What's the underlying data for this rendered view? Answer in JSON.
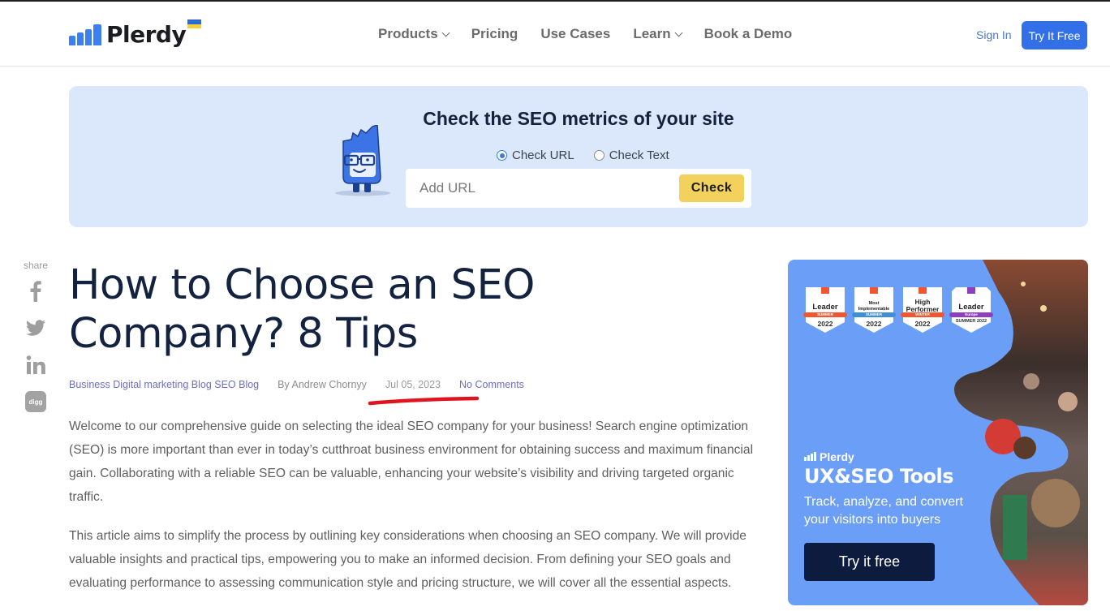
{
  "header": {
    "logo_text": "Plerdy",
    "nav": [
      {
        "label": "Products",
        "has_dropdown": true
      },
      {
        "label": "Pricing",
        "has_dropdown": false
      },
      {
        "label": "Use Cases",
        "has_dropdown": false
      },
      {
        "label": "Learn",
        "has_dropdown": true
      },
      {
        "label": "Book a Demo",
        "has_dropdown": false
      }
    ],
    "sign_in": "Sign In",
    "try_free": "Try It Free",
    "accent_color": "#3370e8"
  },
  "seo_checker": {
    "title": "Check the SEO metrics of your site",
    "radio_options": [
      {
        "label": "Check URL",
        "selected": true
      },
      {
        "label": "Check Text",
        "selected": false
      }
    ],
    "input_value": "",
    "input_placeholder": "Add URL",
    "check_button": "Check",
    "check_button_color": "#f2d15c",
    "background_color": "#dbe8fb"
  },
  "share": {
    "label": "share",
    "icons": [
      "facebook-icon",
      "twitter-icon",
      "linkedin-icon",
      "digg-icon"
    ],
    "digg_text": "digg"
  },
  "article": {
    "title": "How to Choose an SEO Company? 8 Tips",
    "categories": "Business Digital marketing Blog SEO Blog",
    "author": "By Andrew Chornyy",
    "date": "Jul 05, 2023",
    "comments": "No Comments",
    "paragraphs": [
      "Welcome to our comprehensive guide on selecting the ideal SEO company for your business! Search engine optimization (SEO) is more important than ever in today’s cutthroat business environment for obtaining success and maximum financial gain. Collaborating with a reliable SEO can be valuable, enhancing your website’s visibility and driving targeted organic traffic.",
      "This article aims to simplify the process by outlining key considerations when choosing an SEO company. We will provide valuable insights and practical tips, empowering you to make an informed decision. From defining your SEO goals and evaluating performance to assessing communication style and pricing structure, we will cover all the essential aspects."
    ]
  },
  "promo": {
    "badges": [
      {
        "title": "Leader",
        "ribbon": "SUMMER",
        "year": "2022",
        "color": "#f0562f"
      },
      {
        "title": "Most Implementable",
        "ribbon": "SUMMER",
        "year": "2022",
        "color": "#3f8fd8"
      },
      {
        "title": "High Performer",
        "ribbon": "WINTER",
        "year": "2022",
        "color": "#f0562f"
      },
      {
        "title": "Leader",
        "ribbon": "Europe",
        "year": "SUMMER 2022",
        "color": "#8e3fbf"
      }
    ],
    "brand": "Plerdy",
    "title": "UX&SEO Tools",
    "subtitle": "Track, analyze, and convert your visitors into buyers",
    "button": "Try it free",
    "background_color": "#6b9ef6"
  }
}
